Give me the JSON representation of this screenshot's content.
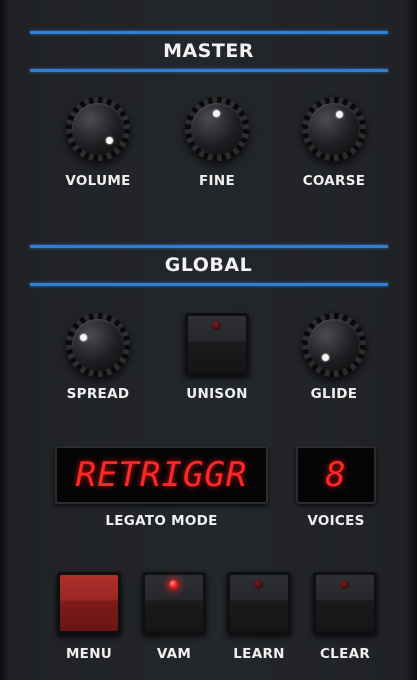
{
  "master": {
    "title": "MASTER",
    "knobs": [
      {
        "label": "VOLUME",
        "icon": "knob-icon"
      },
      {
        "label": "FINE",
        "icon": "knob-icon"
      },
      {
        "label": "COARSE",
        "icon": "knob-icon"
      }
    ]
  },
  "global": {
    "title": "GLOBAL",
    "spread_label": "SPREAD",
    "unison_label": "UNISON",
    "glide_label": "GLIDE",
    "legato_display": "RETRIGGR",
    "legato_label": "LEGATO MODE",
    "voices_display": "8",
    "voices_label": "VOICES"
  },
  "buttons": {
    "menu": "MENU",
    "vam": "VAM",
    "learn": "LEARN",
    "clear": "CLEAR"
  },
  "colors": {
    "accent_line": "#2f7fd6",
    "lcd_text": "#ff2626",
    "menu_button": "#9a2623",
    "led_on": "#ff2020"
  }
}
